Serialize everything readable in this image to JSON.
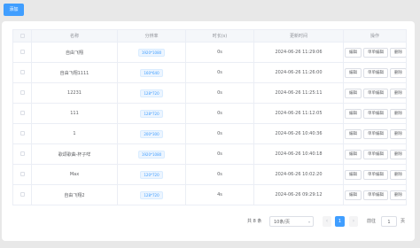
{
  "toolbar": {
    "add_label": "添加"
  },
  "table": {
    "headers": [
      "名称",
      "分辨率",
      "时长(s)",
      "更新时间",
      "操作"
    ],
    "rows": [
      {
        "name": "自由飞翔",
        "resolution": "1920*1080",
        "duration": "0s",
        "updated": "2024-06-26 11:29:06"
      },
      {
        "name": "自由飞翔1111",
        "resolution": "160*640",
        "duration": "0s",
        "updated": "2024-06-26 11:26:00"
      },
      {
        "name": "12231",
        "resolution": "128*720",
        "duration": "0s",
        "updated": "2024-06-26 11:25:11"
      },
      {
        "name": "111",
        "resolution": "128*720",
        "duration": "0s",
        "updated": "2024-06-26 11:12:05"
      },
      {
        "name": "1",
        "resolution": "200*300",
        "duration": "0s",
        "updated": "2024-06-26 10:40:36"
      },
      {
        "name": "歌颂歌曲-杯子咩",
        "resolution": "1920*1080",
        "duration": "0s",
        "updated": "2024-06-26 10:40:18"
      },
      {
        "name": "Max",
        "resolution": "120*720",
        "duration": "0s",
        "updated": "2024-06-26 10:02:20"
      },
      {
        "name": "自由飞翔2",
        "resolution": "128*720",
        "duration": "4s",
        "updated": "2024-06-26 09:29:12"
      }
    ],
    "actions": {
      "edit": "编辑",
      "single_edit": "单单编辑",
      "delete": "删除"
    }
  },
  "pagination": {
    "total": "共 8 条",
    "page_size": "10条/页",
    "current_page": "1",
    "goto_label": "前往",
    "goto_value": "1",
    "page_unit": "页"
  },
  "colors": {
    "primary": "#409eff",
    "page_bg": "#e8e8e8"
  },
  "icons": {
    "prev": "chevron-left-icon",
    "next": "chevron-right-icon",
    "dropdown": "chevron-down-icon"
  }
}
